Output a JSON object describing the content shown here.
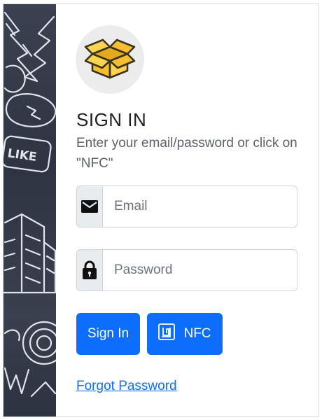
{
  "login": {
    "title": "SIGN IN",
    "subtitle": "Enter your email/password or click on \"NFC\"",
    "email_placeholder": "Email",
    "password_placeholder": "Password",
    "sign_in_label": "Sign In",
    "nfc_label": "NFC",
    "forgot_password_label": "Forgot Password"
  },
  "icons": {
    "logo": "open-box-icon",
    "email": "envelope-icon",
    "password": "lock-icon",
    "nfc": "nfc-icon"
  },
  "colors": {
    "primary": "#0d6efd",
    "sidebar": "#343a48",
    "logo_box": "#f9c53a"
  }
}
